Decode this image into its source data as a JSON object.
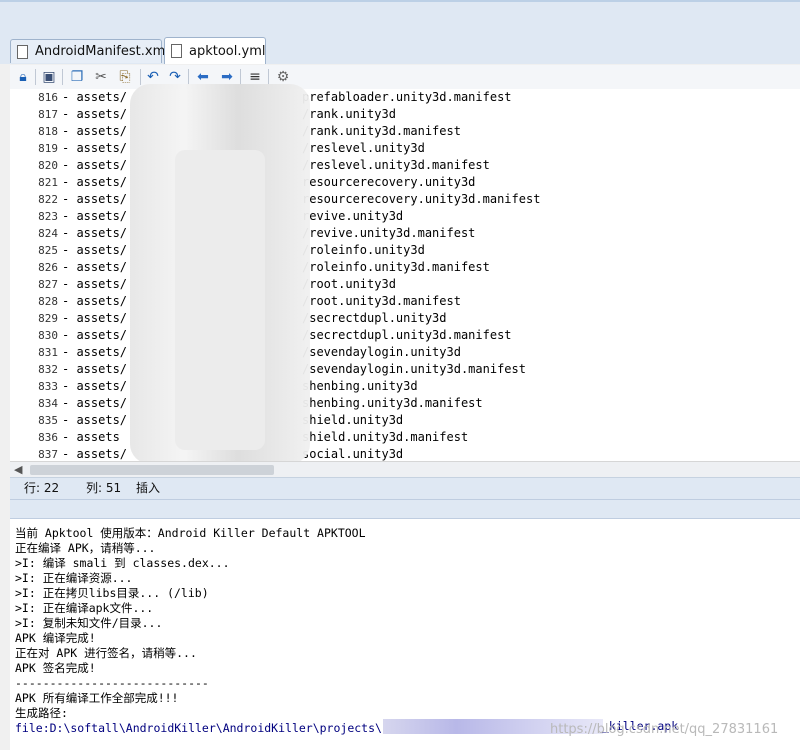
{
  "tabs": [
    {
      "label": "AndroidManifest.xml",
      "active": false
    },
    {
      "label": "apktool.yml",
      "active": true
    }
  ],
  "toolbar": {
    "icons": [
      "lock-icon",
      "save-icon",
      "copy-icon",
      "cut-icon",
      "paste-icon",
      "undo-icon",
      "redo-icon",
      "back-icon",
      "forward-icon",
      "format-icon",
      "settings-icon"
    ]
  },
  "editor": {
    "lines": [
      {
        "n": "816",
        "pre": "- assets/",
        "post": "prefabloader.unity3d.manifest"
      },
      {
        "n": "817",
        "pre": "- assets/",
        "post": "/rank.unity3d"
      },
      {
        "n": "818",
        "pre": "- assets/",
        "post": "/rank.unity3d.manifest"
      },
      {
        "n": "819",
        "pre": "- assets/",
        "post": "/reslevel.unity3d"
      },
      {
        "n": "820",
        "pre": "- assets/",
        "post": "/reslevel.unity3d.manifest"
      },
      {
        "n": "821",
        "pre": "- assets/",
        "post": "resourcerecovery.unity3d"
      },
      {
        "n": "822",
        "pre": "- assets/",
        "post": "resourcerecovery.unity3d.manifest"
      },
      {
        "n": "823",
        "pre": "- assets/",
        "post": "revive.unity3d"
      },
      {
        "n": "824",
        "pre": "- assets/",
        "post": "/revive.unity3d.manifest"
      },
      {
        "n": "825",
        "pre": "- assets/",
        "post": "/roleinfo.unity3d"
      },
      {
        "n": "826",
        "pre": "- assets/",
        "post": "/roleinfo.unity3d.manifest"
      },
      {
        "n": "827",
        "pre": "- assets/",
        "post": "/root.unity3d"
      },
      {
        "n": "828",
        "pre": "- assets/",
        "post": "/root.unity3d.manifest"
      },
      {
        "n": "829",
        "pre": "- assets/",
        "post": "/secrectdupl.unity3d"
      },
      {
        "n": "830",
        "pre": "- assets/",
        "post": "/secrectdupl.unity3d.manifest"
      },
      {
        "n": "831",
        "pre": "- assets/",
        "post": "/sevendaylogin.unity3d"
      },
      {
        "n": "832",
        "pre": "- assets/",
        "post": "/sevendaylogin.unity3d.manifest"
      },
      {
        "n": "833",
        "pre": "- assets/",
        "post": "shenbing.unity3d"
      },
      {
        "n": "834",
        "pre": "- assets/",
        "post": "shenbing.unity3d.manifest"
      },
      {
        "n": "835",
        "pre": "- assets/",
        "post": "shield.unity3d"
      },
      {
        "n": "836",
        "pre": "- assets",
        "post": "shield.unity3d.manifest"
      },
      {
        "n": "837",
        "pre": "- assets/",
        "post": "social.unity3d"
      }
    ]
  },
  "status": {
    "row": "行: 22",
    "col": "列: 51",
    "mode": "插入"
  },
  "console": {
    "lines": [
      "当前 Apktool 使用版本：Android Killer Default APKTOOL",
      "正在编译 APK，请稍等...",
      ">I: 编译 smali 到 classes.dex...",
      ">I: 正在编译资源...",
      ">I: 正在拷贝libs目录... (/lib)",
      ">I: 正在编译apk文件...",
      ">I: 复制未知文件/目录...",
      "APK 编译完成!",
      "正在对 APK 进行签名，请稍等...",
      "APK 签名完成!",
      "----------------------------",
      "APK 所有编译工作全部完成!!!",
      "生成路径:"
    ],
    "path_prefix": "file:D:\\softall\\AndroidKiller\\AndroidKiller\\projects\\",
    "path_suffix": "_killer.apk",
    "watermark": "https://blog.csdn.net/qq_27831161"
  }
}
